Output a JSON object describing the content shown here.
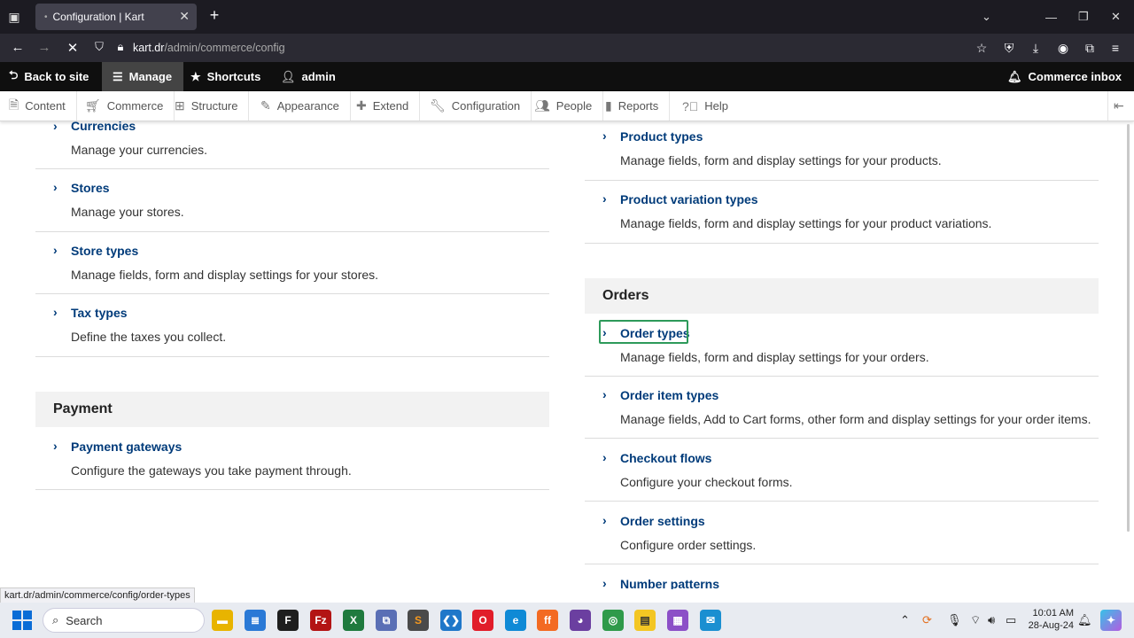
{
  "browser": {
    "tab_title": "Configuration | Kart",
    "url_host": "kart.dr",
    "url_path": "/admin/commerce/config",
    "status_url": "kart.dr/admin/commerce/config/order-types"
  },
  "toolbar": {
    "back": "Back to site",
    "manage": "Manage",
    "shortcuts": "Shortcuts",
    "user": "admin",
    "inbox": "Commerce inbox"
  },
  "tray": [
    "Content",
    "Commerce",
    "Structure",
    "Appearance",
    "Extend",
    "Configuration",
    "People",
    "Reports",
    "Help"
  ],
  "left": {
    "items": [
      {
        "title": "Currencies",
        "desc": "Manage your currencies."
      },
      {
        "title": "Stores",
        "desc": "Manage your stores."
      },
      {
        "title": "Store types",
        "desc": "Manage fields, form and display settings for your stores."
      },
      {
        "title": "Tax types",
        "desc": "Define the taxes you collect."
      }
    ],
    "payment_heading": "Payment",
    "payment_items": [
      {
        "title": "Payment gateways",
        "desc": "Configure the gateways you take payment through."
      }
    ]
  },
  "right": {
    "items": [
      {
        "title": "Product types",
        "desc": "Manage fields, form and display settings for your products."
      },
      {
        "title": "Product variation types",
        "desc": "Manage fields, form and display settings for your product variations."
      }
    ],
    "orders_heading": "Orders",
    "order_items": [
      {
        "title": "Order types",
        "desc": "Manage fields, form and display settings for your orders."
      },
      {
        "title": "Order item types",
        "desc": "Manage fields, Add to Cart forms, other form and display settings for your order items."
      },
      {
        "title": "Checkout flows",
        "desc": "Configure your checkout forms."
      },
      {
        "title": "Order settings",
        "desc": "Configure order settings."
      },
      {
        "title": "Number patterns",
        "desc": ""
      }
    ]
  },
  "taskbar": {
    "search": "Search",
    "time": "10:01 AM",
    "date": "28-Aug-24"
  },
  "colors": {
    "link": "#003b7a",
    "toolbar": "#0f0f0f",
    "focus": "#2d9a5a"
  }
}
